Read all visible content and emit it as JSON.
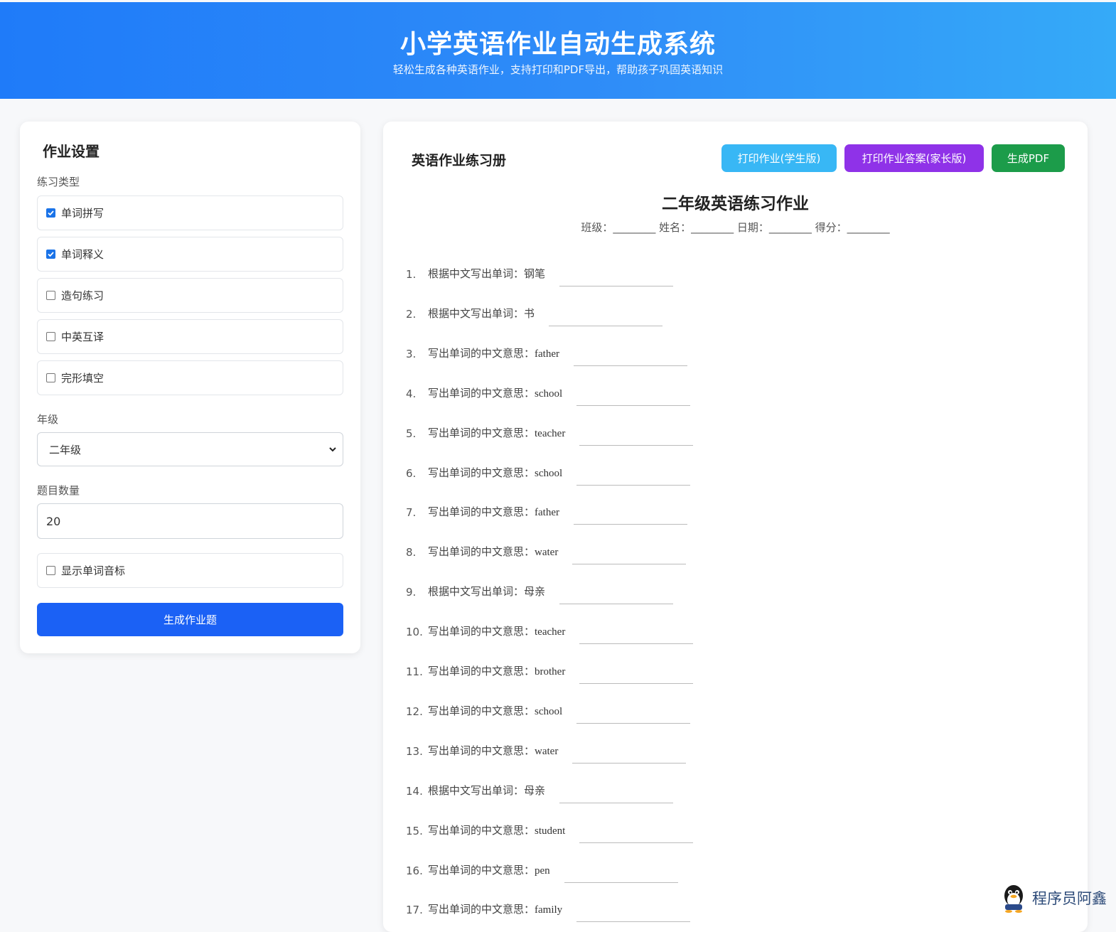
{
  "header": {
    "title": "小学英语作业自动生成系统",
    "subtitle": "轻松生成各种英语作业，支持打印和PDF导出，帮助孩子巩固英语知识"
  },
  "settings": {
    "title": "作业设置",
    "type_label": "练习类型",
    "types": [
      {
        "label": "单词拼写",
        "checked": true
      },
      {
        "label": "单词释义",
        "checked": true
      },
      {
        "label": "造句练习",
        "checked": false
      },
      {
        "label": "中英互译",
        "checked": false
      },
      {
        "label": "完形填空",
        "checked": false
      }
    ],
    "grade_label": "年级",
    "grade_value": "二年级",
    "count_label": "题目数量",
    "count_value": "20",
    "phonetic_label": "显示单词音标",
    "phonetic_checked": false,
    "generate_label": "生成作业题"
  },
  "sheet": {
    "title": "英语作业练习册",
    "print_label": "打印作业(学生版)",
    "answer_label": "打印作业答案(家长版)",
    "pdf_label": "生成PDF",
    "worksheet_title": "二年级英语练习作业",
    "info_line": "班级：________ 姓名：________ 日期：________ 得分：________",
    "questions": [
      {
        "n": "1.",
        "prompt": "根据中文写出单词：",
        "word": "钢笔"
      },
      {
        "n": "2.",
        "prompt": "根据中文写出单词：",
        "word": "书"
      },
      {
        "n": "3.",
        "prompt": "写出单词的中文意思：",
        "word": "father"
      },
      {
        "n": "4.",
        "prompt": "写出单词的中文意思：",
        "word": "school"
      },
      {
        "n": "5.",
        "prompt": "写出单词的中文意思：",
        "word": "teacher"
      },
      {
        "n": "6.",
        "prompt": "写出单词的中文意思：",
        "word": "school"
      },
      {
        "n": "7.",
        "prompt": "写出单词的中文意思：",
        "word": "father"
      },
      {
        "n": "8.",
        "prompt": "写出单词的中文意思：",
        "word": "water"
      },
      {
        "n": "9.",
        "prompt": "根据中文写出单词：",
        "word": "母亲"
      },
      {
        "n": "10.",
        "prompt": "写出单词的中文意思：",
        "word": "teacher"
      },
      {
        "n": "11.",
        "prompt": "写出单词的中文意思：",
        "word": "brother"
      },
      {
        "n": "12.",
        "prompt": "写出单词的中文意思：",
        "word": "school"
      },
      {
        "n": "13.",
        "prompt": "写出单词的中文意思：",
        "word": "water"
      },
      {
        "n": "14.",
        "prompt": "根据中文写出单词：",
        "word": "母亲"
      },
      {
        "n": "15.",
        "prompt": "写出单词的中文意思：",
        "word": "student"
      },
      {
        "n": "16.",
        "prompt": "写出单词的中文意思：",
        "word": "pen"
      },
      {
        "n": "17.",
        "prompt": "写出单词的中文意思：",
        "word": "family"
      }
    ]
  },
  "watermark": {
    "text": "程序员阿鑫",
    "icon": "penguin-icon"
  }
}
